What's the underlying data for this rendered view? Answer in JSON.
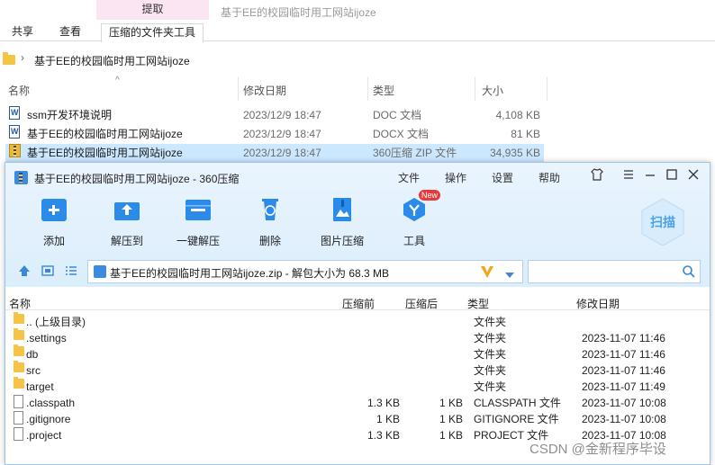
{
  "ribbon": {
    "context_label": "提取",
    "window_title": "基于EE的校园临时用工网站ijoze",
    "tabs": [
      "共享",
      "查看",
      "压缩的文件夹工具"
    ]
  },
  "address": {
    "path": "基于EE的校园临时用工网站ijoze"
  },
  "explorer": {
    "columns": [
      "名称",
      "修改日期",
      "类型",
      "大小"
    ],
    "rows": [
      {
        "name": "ssm开发环境说明",
        "date": "2023/12/9 18:47",
        "type": "DOC 文档",
        "size": "4,108 KB",
        "icon": "word-doc-icon"
      },
      {
        "name": "基于EE的校园临时用工网站ijoze",
        "date": "2023/12/9 18:47",
        "type": "DOCX 文档",
        "size": "81 KB",
        "icon": "word-doc-icon"
      },
      {
        "name": "基于EE的校园临时用工网站ijoze",
        "date": "2023/12/9 18:47",
        "type": "360压缩 ZIP 文件",
        "size": "34,935 KB",
        "icon": "zip-archive-icon",
        "selected": true
      }
    ]
  },
  "zipwin": {
    "title": "基于EE的校园临时用工网站ijoze - 360压缩",
    "menu": [
      "文件",
      "操作",
      "设置",
      "帮助"
    ],
    "tools": [
      "添加",
      "解压到",
      "一键解压",
      "删除",
      "图片压缩",
      "工具"
    ],
    "new_badge": "New",
    "scan_label": "扫描",
    "path": "基于EE的校园临时用工网站ijoze.zip - 解包大小为 68.3 MB",
    "columns": [
      "名称",
      "压缩前",
      "压缩后",
      "类型",
      "修改日期"
    ],
    "rows": [
      {
        "name": ".. (上级目录)",
        "before": "",
        "after": "",
        "type": "文件夹",
        "date": "",
        "kind": "folder"
      },
      {
        "name": ".settings",
        "before": "",
        "after": "",
        "type": "文件夹",
        "date": "2023-11-07 11:46",
        "kind": "folder"
      },
      {
        "name": "db",
        "before": "",
        "after": "",
        "type": "文件夹",
        "date": "2023-11-07 11:46",
        "kind": "folder"
      },
      {
        "name": "src",
        "before": "",
        "after": "",
        "type": "文件夹",
        "date": "2023-11-07 11:46",
        "kind": "folder"
      },
      {
        "name": "target",
        "before": "",
        "after": "",
        "type": "文件夹",
        "date": "2023-11-07 11:49",
        "kind": "folder"
      },
      {
        "name": ".classpath",
        "before": "1.3 KB",
        "after": "1 KB",
        "type": "CLASSPATH 文件",
        "date": "2023-11-07 10:08",
        "kind": "file"
      },
      {
        "name": ".gitignore",
        "before": "1 KB",
        "after": "1 KB",
        "type": "GITIGNORE 文件",
        "date": "2023-11-07 10:08",
        "kind": "file"
      },
      {
        "name": ".project",
        "before": "1.3 KB",
        "after": "1 KB",
        "type": "PROJECT 文件",
        "date": "2023-11-07 10:08",
        "kind": "file"
      }
    ]
  },
  "watermark": "CSDN @金新程序毕设",
  "colors": {
    "accent": "#2a8be8",
    "selection": "#cce8ff",
    "ribbon_context": "#fbe5f2",
    "folder": "#f6c445"
  }
}
